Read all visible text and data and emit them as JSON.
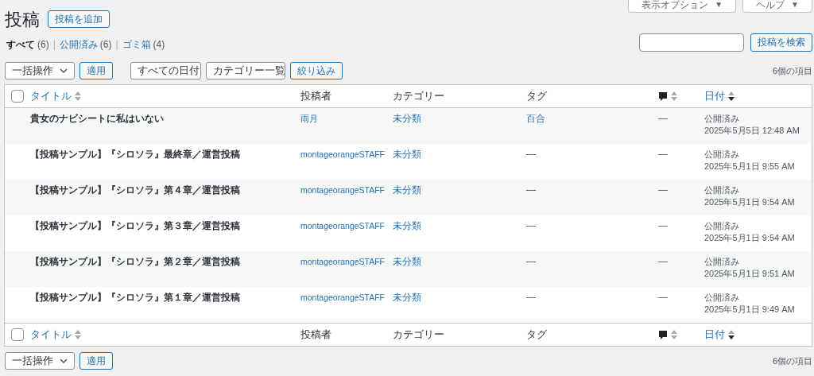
{
  "screen_options": [
    {
      "label": "表示オプション",
      "caret": "▼"
    },
    {
      "label": "ヘルプ",
      "caret": "▼"
    }
  ],
  "page_title": "投稿",
  "add_new_button": "投稿を追加",
  "status_filters": [
    {
      "label": "すべて",
      "count": "(6)",
      "selected": true
    },
    {
      "separator": "|",
      "label": "公開済み",
      "count": "(6)",
      "selected": false
    },
    {
      "separator": "|",
      "label": "ゴミ箱",
      "count": "(4)",
      "selected": false
    }
  ],
  "search": {
    "button": "投稿を検索"
  },
  "top_actions": {
    "bulk_select": "一括操作",
    "apply": "適用",
    "date_filter": "すべての日付",
    "category_filter": "カテゴリー一覧",
    "filter_button": "絞り込み",
    "item_count": "6個の項目"
  },
  "table": {
    "select_all_checked": false,
    "columns": [
      {
        "kind": "title",
        "label": "タイトル",
        "sortable": true,
        "sorted_descending": false
      },
      {
        "kind": "author",
        "label": "投稿者",
        "sortable": false
      },
      {
        "kind": "category",
        "label": "カテゴリー",
        "sortable": false
      },
      {
        "kind": "tag",
        "label": "タグ",
        "sortable": false
      },
      {
        "kind": "comments",
        "sortable": true,
        "sorted_descending": false
      },
      {
        "kind": "date",
        "label": "日付",
        "sortable": true,
        "sorted_descending": true
      }
    ],
    "rows": [
      {
        "title": "貴女のナビシートに私はいない",
        "author": "雨月",
        "category": "未分類",
        "tag": "百合",
        "tag_link": true,
        "comments": "—",
        "status": "公開済み",
        "date": "2025年5月5日 12:48 AM"
      },
      {
        "title": "【投稿サンプル】『シロソラ』最終章／運営投稿",
        "author": "montageorangeSTAFF",
        "category": "未分類",
        "tag": "—",
        "tag_link": false,
        "comments": "—",
        "status": "公開済み",
        "date": "2025年5月1日 9:55 AM"
      },
      {
        "title": "【投稿サンプル】『シロソラ』第４章／運営投稿",
        "author": "montageorangeSTAFF",
        "category": "未分類",
        "tag": "—",
        "tag_link": false,
        "comments": "—",
        "status": "公開済み",
        "date": "2025年5月1日 9:54 AM"
      },
      {
        "title": "【投稿サンプル】『シロソラ』第３章／運営投稿",
        "author": "montageorangeSTAFF",
        "category": "未分類",
        "tag": "—",
        "tag_link": false,
        "comments": "—",
        "status": "公開済み",
        "date": "2025年5月1日 9:54 AM"
      },
      {
        "title": "【投稿サンプル】『シロソラ』第２章／運営投稿",
        "author": "montageorangeSTAFF",
        "category": "未分類",
        "tag": "—",
        "tag_link": false,
        "comments": "—",
        "status": "公開済み",
        "date": "2025年5月1日 9:51 AM"
      },
      {
        "title": "【投稿サンプル】『シロソラ』第１章／運営投稿",
        "author": "montageorangeSTAFF",
        "category": "未分類",
        "tag": "—",
        "tag_link": false,
        "comments": "—",
        "status": "公開済み",
        "date": "2025年5月1日 9:49 AM"
      }
    ],
    "footer_select_all_checked": false,
    "footer_columns": [
      {
        "kind": "title",
        "label": "タイトル",
        "sortable": true,
        "sorted_descending": false
      },
      {
        "kind": "author",
        "label": "投稿者",
        "sortable": false
      },
      {
        "kind": "category",
        "label": "カテゴリー",
        "sortable": false
      },
      {
        "kind": "tag",
        "label": "タグ",
        "sortable": false
      },
      {
        "kind": "comments",
        "sortable": true,
        "sorted_descending": false
      },
      {
        "kind": "date",
        "label": "日付",
        "sortable": true,
        "sorted_descending": true
      }
    ]
  },
  "bottom_actions": {
    "bulk_select": "一括操作",
    "apply": "適用",
    "item_count": "6個の項目"
  }
}
